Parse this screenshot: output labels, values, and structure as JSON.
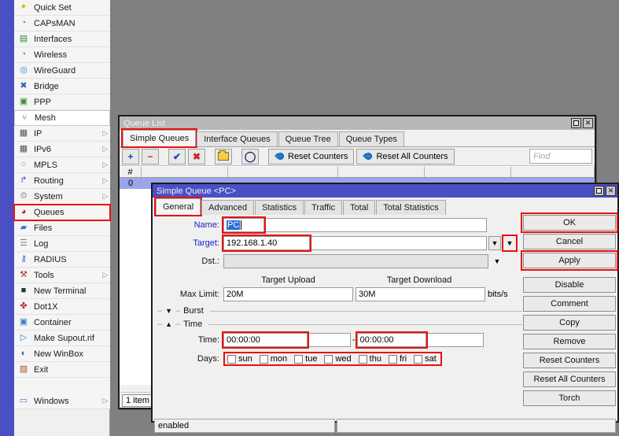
{
  "sidebar": {
    "items": [
      {
        "label": "Quick Set",
        "icon": "wand-icon",
        "arrow": false,
        "state": "normal"
      },
      {
        "label": "CAPsMAN",
        "icon": "capsman-icon",
        "arrow": false,
        "state": "normal"
      },
      {
        "label": "Interfaces",
        "icon": "interfaces-icon",
        "arrow": false,
        "state": "normal"
      },
      {
        "label": "Wireless",
        "icon": "wireless-icon",
        "arrow": false,
        "state": "normal"
      },
      {
        "label": "WireGuard",
        "icon": "wireguard-icon",
        "arrow": false,
        "state": "normal"
      },
      {
        "label": "Bridge",
        "icon": "bridge-icon",
        "arrow": false,
        "state": "normal"
      },
      {
        "label": "PPP",
        "icon": "ppp-icon",
        "arrow": false,
        "state": "normal"
      },
      {
        "label": "Mesh",
        "icon": "mesh-icon",
        "arrow": false,
        "state": "hovered"
      },
      {
        "label": "IP",
        "icon": "ip-icon",
        "arrow": true,
        "state": "normal"
      },
      {
        "label": "IPv6",
        "icon": "ipv6-icon",
        "arrow": true,
        "state": "normal"
      },
      {
        "label": "MPLS",
        "icon": "mpls-icon",
        "arrow": true,
        "state": "normal"
      },
      {
        "label": "Routing",
        "icon": "routing-icon",
        "arrow": true,
        "state": "normal"
      },
      {
        "label": "System",
        "icon": "system-icon",
        "arrow": true,
        "state": "normal"
      },
      {
        "label": "Queues",
        "icon": "queues-icon",
        "arrow": false,
        "state": "highlighted"
      },
      {
        "label": "Files",
        "icon": "folder-icon",
        "arrow": false,
        "state": "normal"
      },
      {
        "label": "Log",
        "icon": "log-icon",
        "arrow": false,
        "state": "normal"
      },
      {
        "label": "RADIUS",
        "icon": "radius-icon",
        "arrow": false,
        "state": "normal"
      },
      {
        "label": "Tools",
        "icon": "tools-icon",
        "arrow": true,
        "state": "normal"
      },
      {
        "label": "New Terminal",
        "icon": "terminal-icon",
        "arrow": false,
        "state": "normal"
      },
      {
        "label": "Dot1X",
        "icon": "dot1x-icon",
        "arrow": false,
        "state": "normal"
      },
      {
        "label": "Container",
        "icon": "container-icon",
        "arrow": false,
        "state": "normal"
      },
      {
        "label": "Make Supout.rif",
        "icon": "supout-icon",
        "arrow": false,
        "state": "normal"
      },
      {
        "label": "New WinBox",
        "icon": "winbox-icon",
        "arrow": false,
        "state": "normal"
      },
      {
        "label": "Exit",
        "icon": "exit-icon",
        "arrow": false,
        "state": "normal"
      },
      {
        "label": "",
        "icon": "",
        "arrow": false,
        "state": "blank"
      },
      {
        "label": "Windows",
        "icon": "windows-icon",
        "arrow": true,
        "state": "normal"
      }
    ]
  },
  "queue_list": {
    "title": "Queue List",
    "window_buttons": {
      "maximize": "maximize-icon",
      "close": "close-icon"
    },
    "tabs": [
      {
        "label": "Simple Queues",
        "active": true,
        "highlighted": true
      },
      {
        "label": "Interface Queues",
        "active": false,
        "highlighted": false
      },
      {
        "label": "Queue Tree",
        "active": false,
        "highlighted": false
      },
      {
        "label": "Queue Types",
        "active": false,
        "highlighted": false
      }
    ],
    "toolbar": {
      "add": "+",
      "remove": "−",
      "enable": "✔",
      "disable": "✖",
      "comment": "folder-icon",
      "filter": "funnel-icon",
      "reset_counters": "Reset Counters",
      "reset_all_counters": "Reset All Counters"
    },
    "find_placeholder": "Find",
    "columns": [
      "#",
      "",
      "",
      "",
      "",
      ""
    ],
    "rows": [
      {
        "index": "0",
        "selected": true
      }
    ],
    "status": "1 item ("
  },
  "simple_queue_dialog": {
    "title": "Simple Queue <PC>",
    "window_buttons": {
      "maximize": "maximize-icon",
      "close": "close-icon"
    },
    "tabs": [
      {
        "label": "General",
        "active": true,
        "highlighted": true
      },
      {
        "label": "Advanced",
        "active": false,
        "highlighted": false
      },
      {
        "label": "Statistics",
        "active": false,
        "highlighted": false
      },
      {
        "label": "Traffic",
        "active": false,
        "highlighted": false
      },
      {
        "label": "Total",
        "active": false,
        "highlighted": false
      },
      {
        "label": "Total Statistics",
        "active": false,
        "highlighted": false
      }
    ],
    "fields": {
      "name_label": "Name:",
      "name_value": "PC",
      "target_label": "Target:",
      "target_value": "192.168.1.40",
      "dst_label": "Dst.:",
      "dst_value": "",
      "max_limit_label": "Max Limit:",
      "target_upload_header": "Target Upload",
      "target_download_header": "Target Download",
      "max_limit_upload": "20M",
      "max_limit_download": "30M",
      "bits_unit": "bits/s",
      "burst_section": "Burst",
      "time_section": "Time",
      "time_label": "Time:",
      "time_from": "00:00:00",
      "time_to": "00:00:00",
      "time_separator": "-",
      "days_label": "Days:",
      "days": [
        {
          "label": "sun",
          "checked": false
        },
        {
          "label": "mon",
          "checked": false
        },
        {
          "label": "tue",
          "checked": false
        },
        {
          "label": "wed",
          "checked": false
        },
        {
          "label": "thu",
          "checked": false
        },
        {
          "label": "fri",
          "checked": false
        },
        {
          "label": "sat",
          "checked": false
        }
      ]
    },
    "buttons": [
      {
        "label": "OK",
        "highlighted": true,
        "gap_before": false
      },
      {
        "label": "Cancel",
        "highlighted": false,
        "gap_before": false
      },
      {
        "label": "Apply",
        "highlighted": true,
        "gap_before": false
      },
      {
        "label": "Disable",
        "highlighted": false,
        "gap_before": true
      },
      {
        "label": "Comment",
        "highlighted": false,
        "gap_before": false
      },
      {
        "label": "Copy",
        "highlighted": false,
        "gap_before": false
      },
      {
        "label": "Remove",
        "highlighted": false,
        "gap_before": false
      },
      {
        "label": "Reset Counters",
        "highlighted": false,
        "gap_before": false
      },
      {
        "label": "Reset All Counters",
        "highlighted": false,
        "gap_before": false
      },
      {
        "label": "Torch",
        "highlighted": false,
        "gap_before": false
      }
    ],
    "status_text": "enabled",
    "status_text_2": ""
  },
  "colors": {
    "accent_blue": "#4b4fc4",
    "highlight_red": "#e81010",
    "label_blue": "#1a1ad0",
    "selection_blue": "#9aa5e8",
    "desktop_gray": "#808080"
  }
}
